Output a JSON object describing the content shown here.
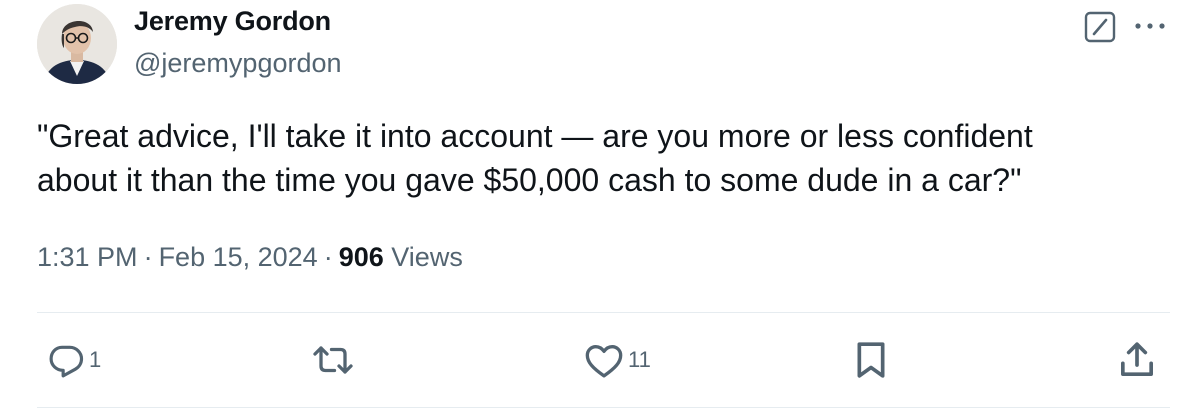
{
  "author": {
    "name": "Jeremy Gordon",
    "handle": "@jeremypgordon",
    "avatar_icon": "profile-photo"
  },
  "header_actions": {
    "grok_icon": "grok-icon",
    "more_icon": "more-horizontal-icon"
  },
  "tweet": {
    "text_lines": [
      "\"Great advice, I'll take it into account — are you more or less confident",
      "about it than the time you gave $50,000 cash to some dude in a car?\""
    ]
  },
  "meta": {
    "time": "1:31 PM",
    "separator": "·",
    "date": "Feb 15, 2024",
    "views_count": "906",
    "views_label": "Views"
  },
  "actions": {
    "reply": {
      "icon": "reply-icon",
      "count": "1"
    },
    "retweet": {
      "icon": "retweet-icon",
      "count": ""
    },
    "like": {
      "icon": "heart-icon",
      "count": "11"
    },
    "bookmark": {
      "icon": "bookmark-icon",
      "count": ""
    },
    "share": {
      "icon": "share-icon",
      "count": ""
    }
  },
  "colors": {
    "text_primary": "#0f1419",
    "text_secondary": "#536471",
    "divider": "#e6ecf0"
  }
}
